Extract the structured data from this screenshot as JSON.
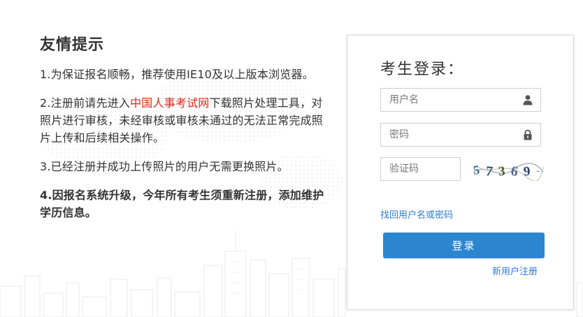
{
  "notice": {
    "title": "友情提示",
    "item1": "1.为保证报名顺畅，推荐使用IE10及以上版本浏览器。",
    "item2_prefix": "2.注册前请先进入",
    "item2_link": "中国人事考试网",
    "item2_suffix": "下载照片处理工具，对照片进行审核，未经审核或审核未通过的无法正常完成照片上传和后续相关操作。",
    "item3": "3.已经注册并成功上传照片的用户无需更换照片。",
    "item4": "4.因报名系统升级，今年所有考生须重新注册，添加维护学历信息。"
  },
  "login": {
    "title": "考生登录：",
    "username_placeholder": "用户名",
    "password_placeholder": "密码",
    "captcha_placeholder": "验证码",
    "captcha_text": "57369",
    "forgot_label": "找回用户名或密码",
    "submit_label": "登录",
    "register_label": "新用户注册"
  },
  "colors": {
    "accent_blue": "#2c86cf",
    "link_blue": "#2a7bd6",
    "highlight_red": "#e0271b"
  },
  "icons": {
    "username": "user-icon",
    "password": "lock-icon"
  }
}
